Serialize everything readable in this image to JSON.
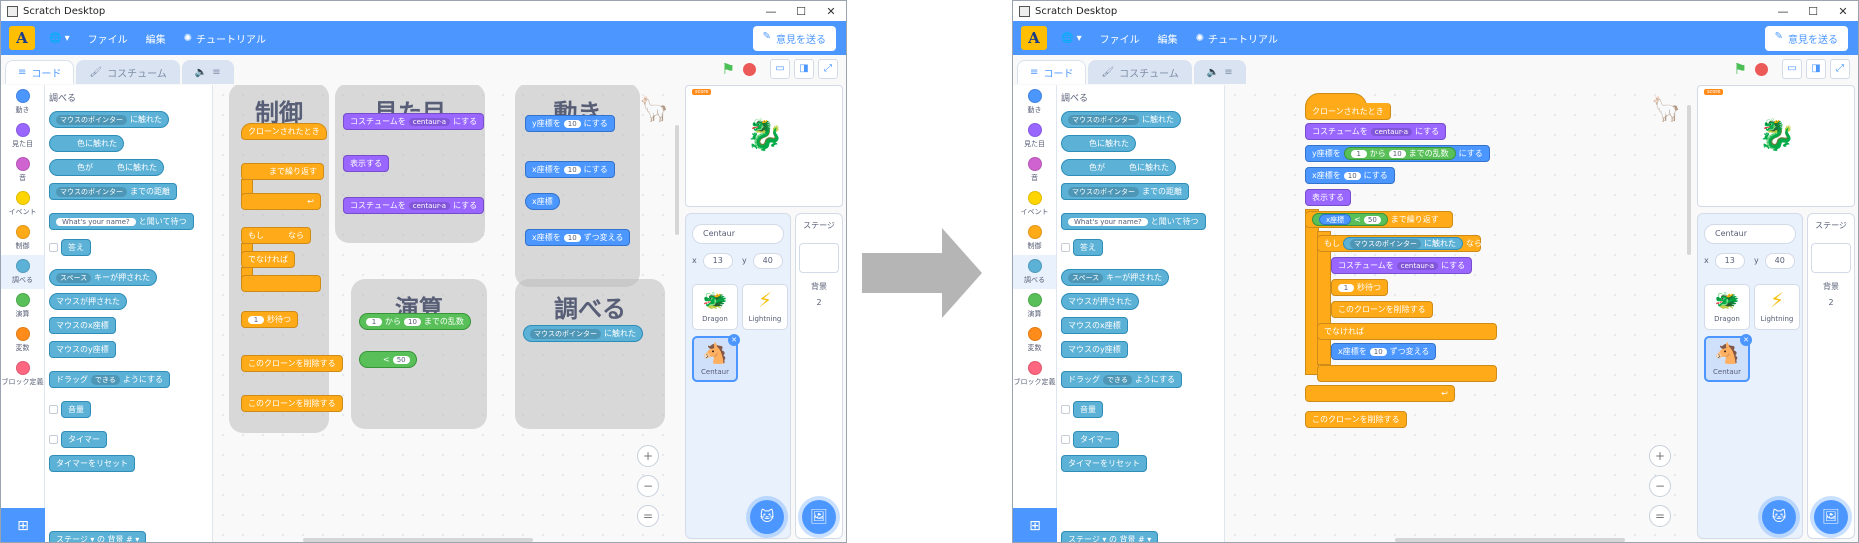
{
  "window": {
    "title": "Scratch Desktop",
    "controls": [
      "—",
      "☐",
      "✕"
    ]
  },
  "menu": {
    "logo": "A",
    "globe": "🌐 ▾",
    "file": "ファイル",
    "edit": "編集",
    "tutorial": "チュートリアル",
    "feedback": "意見を送る"
  },
  "tabs": {
    "code": "コード",
    "costume": "コスチューム",
    "sound": "≡"
  },
  "categories": [
    {
      "label": "動き",
      "color": "#4c97ff"
    },
    {
      "label": "見た目",
      "color": "#9966ff"
    },
    {
      "label": "音",
      "color": "#cf63cf"
    },
    {
      "label": "イベント",
      "color": "#ffd500"
    },
    {
      "label": "制御",
      "color": "#ffab19"
    },
    {
      "label": "調べる",
      "color": "#5cb1d6"
    },
    {
      "label": "演算",
      "color": "#59c059"
    },
    {
      "label": "変数",
      "color": "#ff8c1a"
    },
    {
      "label": "ブロック定義",
      "color": "#ff6680"
    }
  ],
  "palette": {
    "heading": "調べる",
    "touching_mouse": "マウスのポインター",
    "touching_suffix": "に触れた",
    "touching_color": "色に触れた",
    "color_prefix": "色が",
    "color_suffix": "色に触れた",
    "distance_dd": "マウスのポインター",
    "distance_suffix": "までの距離",
    "ask": "What's your name?",
    "ask_suffix": "と聞いて待つ",
    "answer": "答え",
    "key_dd": "スペース",
    "key_suffix": "キーが押された",
    "mouse_down": "マウスが押された",
    "mouse_x": "マウスのx座標",
    "mouse_y": "マウスのy座標",
    "drag_prefix": "ドラッグ",
    "drag_dd": "できる",
    "drag_suffix": "ようにする",
    "loudness": "音量",
    "timer": "タイマー",
    "reset_timer": "タイマーをリセット",
    "stage_of": "ステージ ▾ の 背景 # ▾"
  },
  "left_groups": {
    "control": {
      "title": "制御",
      "when_clone": "クローンされたとき",
      "repeat_until": "まで繰り返す",
      "if": "もし",
      "then": "なら",
      "else": "でなければ",
      "wait_num": "1",
      "wait": "秒待つ",
      "delete_clone": "このクローンを削除する",
      "delete_clone2": "このクローンを削除する"
    },
    "looks": {
      "title": "見た目",
      "switch": "コスチュームを",
      "costume": "centaur-a",
      "switch_suffix": "にする",
      "show": "表示する",
      "switch2": "コスチュームを",
      "costume2": "centaur-a",
      "switch2_suffix": "にする"
    },
    "motion": {
      "title": "動き",
      "sety": "y座標を",
      "sety_val": "10",
      "sety_suffix": "にする",
      "setx": "x座標を",
      "setx_val": "10",
      "setx_suffix": "にする",
      "xpos": "x座標",
      "changex": "x座標を",
      "changex_val": "10",
      "changex_suffix": "ずつ変える"
    },
    "operators": {
      "title": "演算",
      "rand_from": "1",
      "rand_mid": "から",
      "rand_to": "10",
      "rand_suffix": "までの乱数",
      "lt_op": "<",
      "lt_val": "50"
    },
    "sensing": {
      "title": "調べる",
      "touch_dd": "マウスのポインター",
      "touch_suffix": "に触れた"
    }
  },
  "right_script": {
    "when_clone": "クローンされたとき",
    "switch": "コスチュームを",
    "costume": "centaur-a",
    "switch_suffix": "にする",
    "sety": "y座標を",
    "rand_from": "1",
    "rand_mid": "から",
    "rand_to": "10",
    "rand_suffix": "までの乱数",
    "sety_suffix": "にする",
    "setx": "x座標を",
    "setx_val": "10",
    "setx_suffix": "にする",
    "show": "表示する",
    "xpos": "x座標",
    "lt_op": "<",
    "lt_val": "50",
    "repeat_until": "まで繰り返す",
    "if": "もし",
    "touch_dd": "マウスのポインター",
    "touch_suffix": "に触れた",
    "then": "なら",
    "switch2": "コスチュームを",
    "costume2": "centaur-a",
    "switch2_suffix": "にする",
    "wait_num": "1",
    "wait": "秒待つ",
    "delete_clone": "このクローンを削除する",
    "else": "でなければ",
    "changex": "x座標を",
    "changex_val": "10",
    "changex_suffix": "ずつ変える",
    "delete_clone2": "このクローンを削除する"
  },
  "sprite_pane": {
    "name": "Centaur",
    "x_label": "x",
    "x": "13",
    "y_label": "y",
    "y": "40",
    "sprites": [
      "Dragon",
      "Lightning",
      "Centaur"
    ],
    "stage_label": "ステージ",
    "backdrops_label": "背景",
    "backdrops_count": "2"
  },
  "zoom": {
    "in": "+",
    "out": "−",
    "reset": "="
  }
}
